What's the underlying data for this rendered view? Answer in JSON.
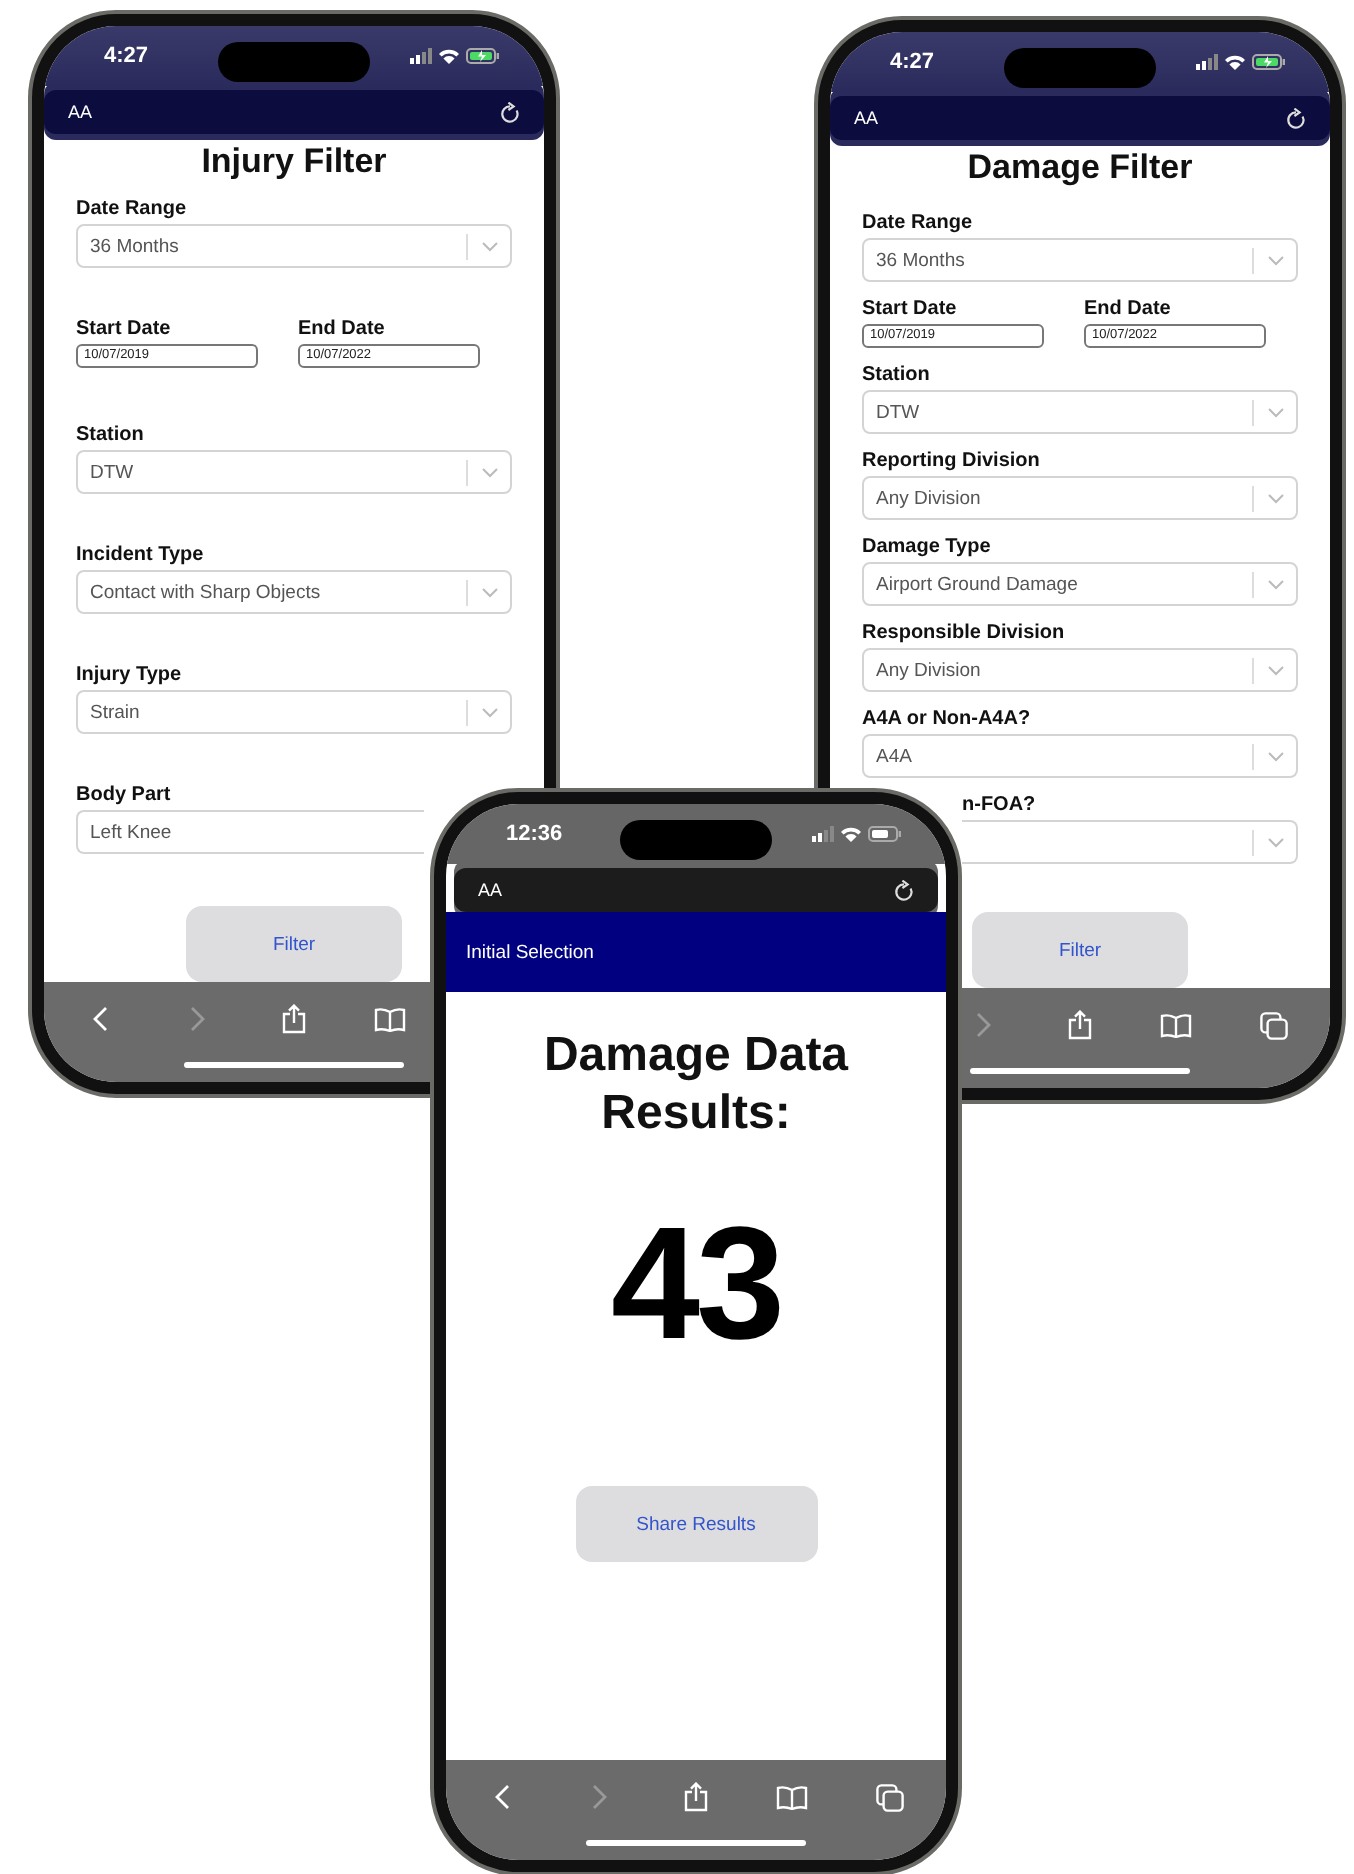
{
  "phones": [
    {
      "kind": "filter",
      "time": "4:27",
      "charging": true,
      "text_size_button": "AA",
      "title": "Injury Filter",
      "fields": [
        {
          "kind": "select",
          "label": "Date Range",
          "value": "36 Months"
        },
        {
          "kind": "dates",
          "start_label": "Start Date",
          "start_value": "10/07/2019",
          "end_label": "End Date",
          "end_value": "10/07/2022"
        },
        {
          "kind": "select",
          "label": "Station",
          "value": "DTW"
        },
        {
          "kind": "select",
          "label": "Incident Type",
          "value": "Contact with Sharp Objects"
        },
        {
          "kind": "select",
          "label": "Injury Type",
          "value": "Strain"
        },
        {
          "kind": "cut",
          "label": "Body Part",
          "value": "Left Knee"
        }
      ],
      "button": "Filter"
    },
    {
      "kind": "filter",
      "time": "4:27",
      "charging": true,
      "text_size_button": "AA",
      "title": "Damage Filter",
      "fields": [
        {
          "kind": "select",
          "label": "Date Range",
          "value": "36 Months"
        },
        {
          "kind": "dates",
          "start_label": "Start Date",
          "start_value": "10/07/2019",
          "end_label": "End Date",
          "end_value": "10/07/2022"
        },
        {
          "kind": "select",
          "label": "Station",
          "value": "DTW"
        },
        {
          "kind": "select",
          "label": "Reporting Division",
          "value": "Any Division"
        },
        {
          "kind": "select",
          "label": "Damage Type",
          "value": "Airport Ground Damage"
        },
        {
          "kind": "select",
          "label": "Responsible Division",
          "value": "Any Division"
        },
        {
          "kind": "select",
          "label": "A4A or Non-A4A?",
          "value": "A4A"
        },
        {
          "kind": "covered",
          "label": "n-FOA?"
        }
      ],
      "button": "Filter"
    },
    {
      "kind": "result",
      "time": "12:36",
      "charging": false,
      "text_size_button": "AA",
      "header": "Initial Selection",
      "title": "Damage Data Results:",
      "count": "43",
      "button": "Share Results"
    }
  ]
}
